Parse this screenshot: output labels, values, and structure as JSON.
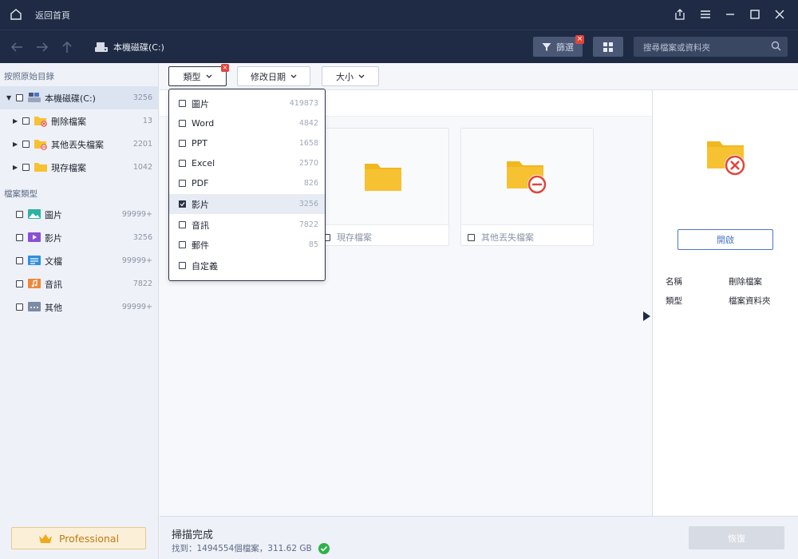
{
  "titlebar": {
    "back_home": "返回首頁",
    "icons": [
      "home-icon",
      "export-icon",
      "menu-icon",
      "minimize-icon",
      "maximize-icon",
      "close-icon"
    ]
  },
  "toolbar": {
    "drive_label": "本機磁碟(C:)",
    "filter_label": "篩選",
    "search_placeholder": "搜尋檔案或資料夾"
  },
  "sidebar": {
    "path_section_title": "按照原始目錄",
    "path_items": [
      {
        "label": "本機磁碟(C:)",
        "count": "3256"
      },
      {
        "label": "刪除檔案",
        "count": "13"
      },
      {
        "label": "其他丟失檔案",
        "count": "2201"
      },
      {
        "label": "現存檔案",
        "count": "1042"
      }
    ],
    "type_section_title": "檔案類型",
    "type_items": [
      {
        "label": "圖片",
        "count": "99999+"
      },
      {
        "label": "影片",
        "count": "3256"
      },
      {
        "label": "文檔",
        "count": "99999+"
      },
      {
        "label": "音訊",
        "count": "7822"
      },
      {
        "label": "其他",
        "count": "99999+"
      }
    ],
    "pro_label": "Professional"
  },
  "filterbar": {
    "type_chip": "類型",
    "date_chip": "修改日期",
    "size_chip": "大小"
  },
  "dropdown": {
    "items": [
      {
        "label": "圖片",
        "count": "419873",
        "checked": false
      },
      {
        "label": "Word",
        "count": "4842",
        "checked": false
      },
      {
        "label": "PPT",
        "count": "1658",
        "checked": false
      },
      {
        "label": "Excel",
        "count": "2570",
        "checked": false
      },
      {
        "label": "PDF",
        "count": "826",
        "checked": false
      },
      {
        "label": "影片",
        "count": "3256",
        "checked": true
      },
      {
        "label": "音訊",
        "count": "7822",
        "checked": false
      },
      {
        "label": "郵件",
        "count": "85",
        "checked": false
      },
      {
        "label": "自定義",
        "count": "",
        "checked": false
      }
    ]
  },
  "main": {
    "cards": [
      {
        "label": "現存檔案"
      },
      {
        "label": "其他丟失檔案"
      }
    ]
  },
  "rpanel": {
    "open_label": "開啟",
    "props": [
      {
        "key": "名稱",
        "value": "刪除檔案"
      },
      {
        "key": "類型",
        "value": "檔案資料夾"
      }
    ]
  },
  "status": {
    "title": "掃描完成",
    "summary": "找到：1494554個檔案，311.62 GB",
    "recover_label": "恢復"
  },
  "colors": {
    "titlebar_bg": "#1f2b44",
    "accent_blue": "#4a76c9",
    "folder_yellow": "#f6c231",
    "delete_red": "#e0453b",
    "success_green": "#2db24a"
  }
}
